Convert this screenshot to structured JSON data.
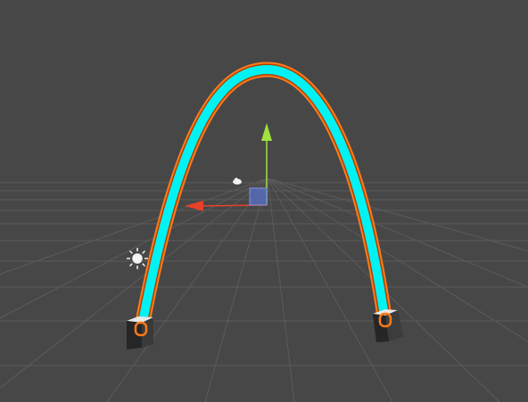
{
  "app": {
    "view": "scene-view"
  },
  "scene": {
    "background_color": "#474747",
    "grid_color": "#5c5c5c",
    "arc": {
      "fill_color": "#00f0f0",
      "outline_color": "#ff7a1a"
    },
    "objects": [
      {
        "name": "left-cube",
        "selected": false
      },
      {
        "name": "right-cube",
        "selected": false
      },
      {
        "name": "arc-line",
        "selected": true
      }
    ]
  },
  "gizmo": {
    "x_axis_color": "#e8402a",
    "y_axis_color": "#a0e040",
    "center_color": "#5870c8"
  },
  "icons": {
    "light": "sun-icon",
    "camera": "cloud-icon"
  }
}
